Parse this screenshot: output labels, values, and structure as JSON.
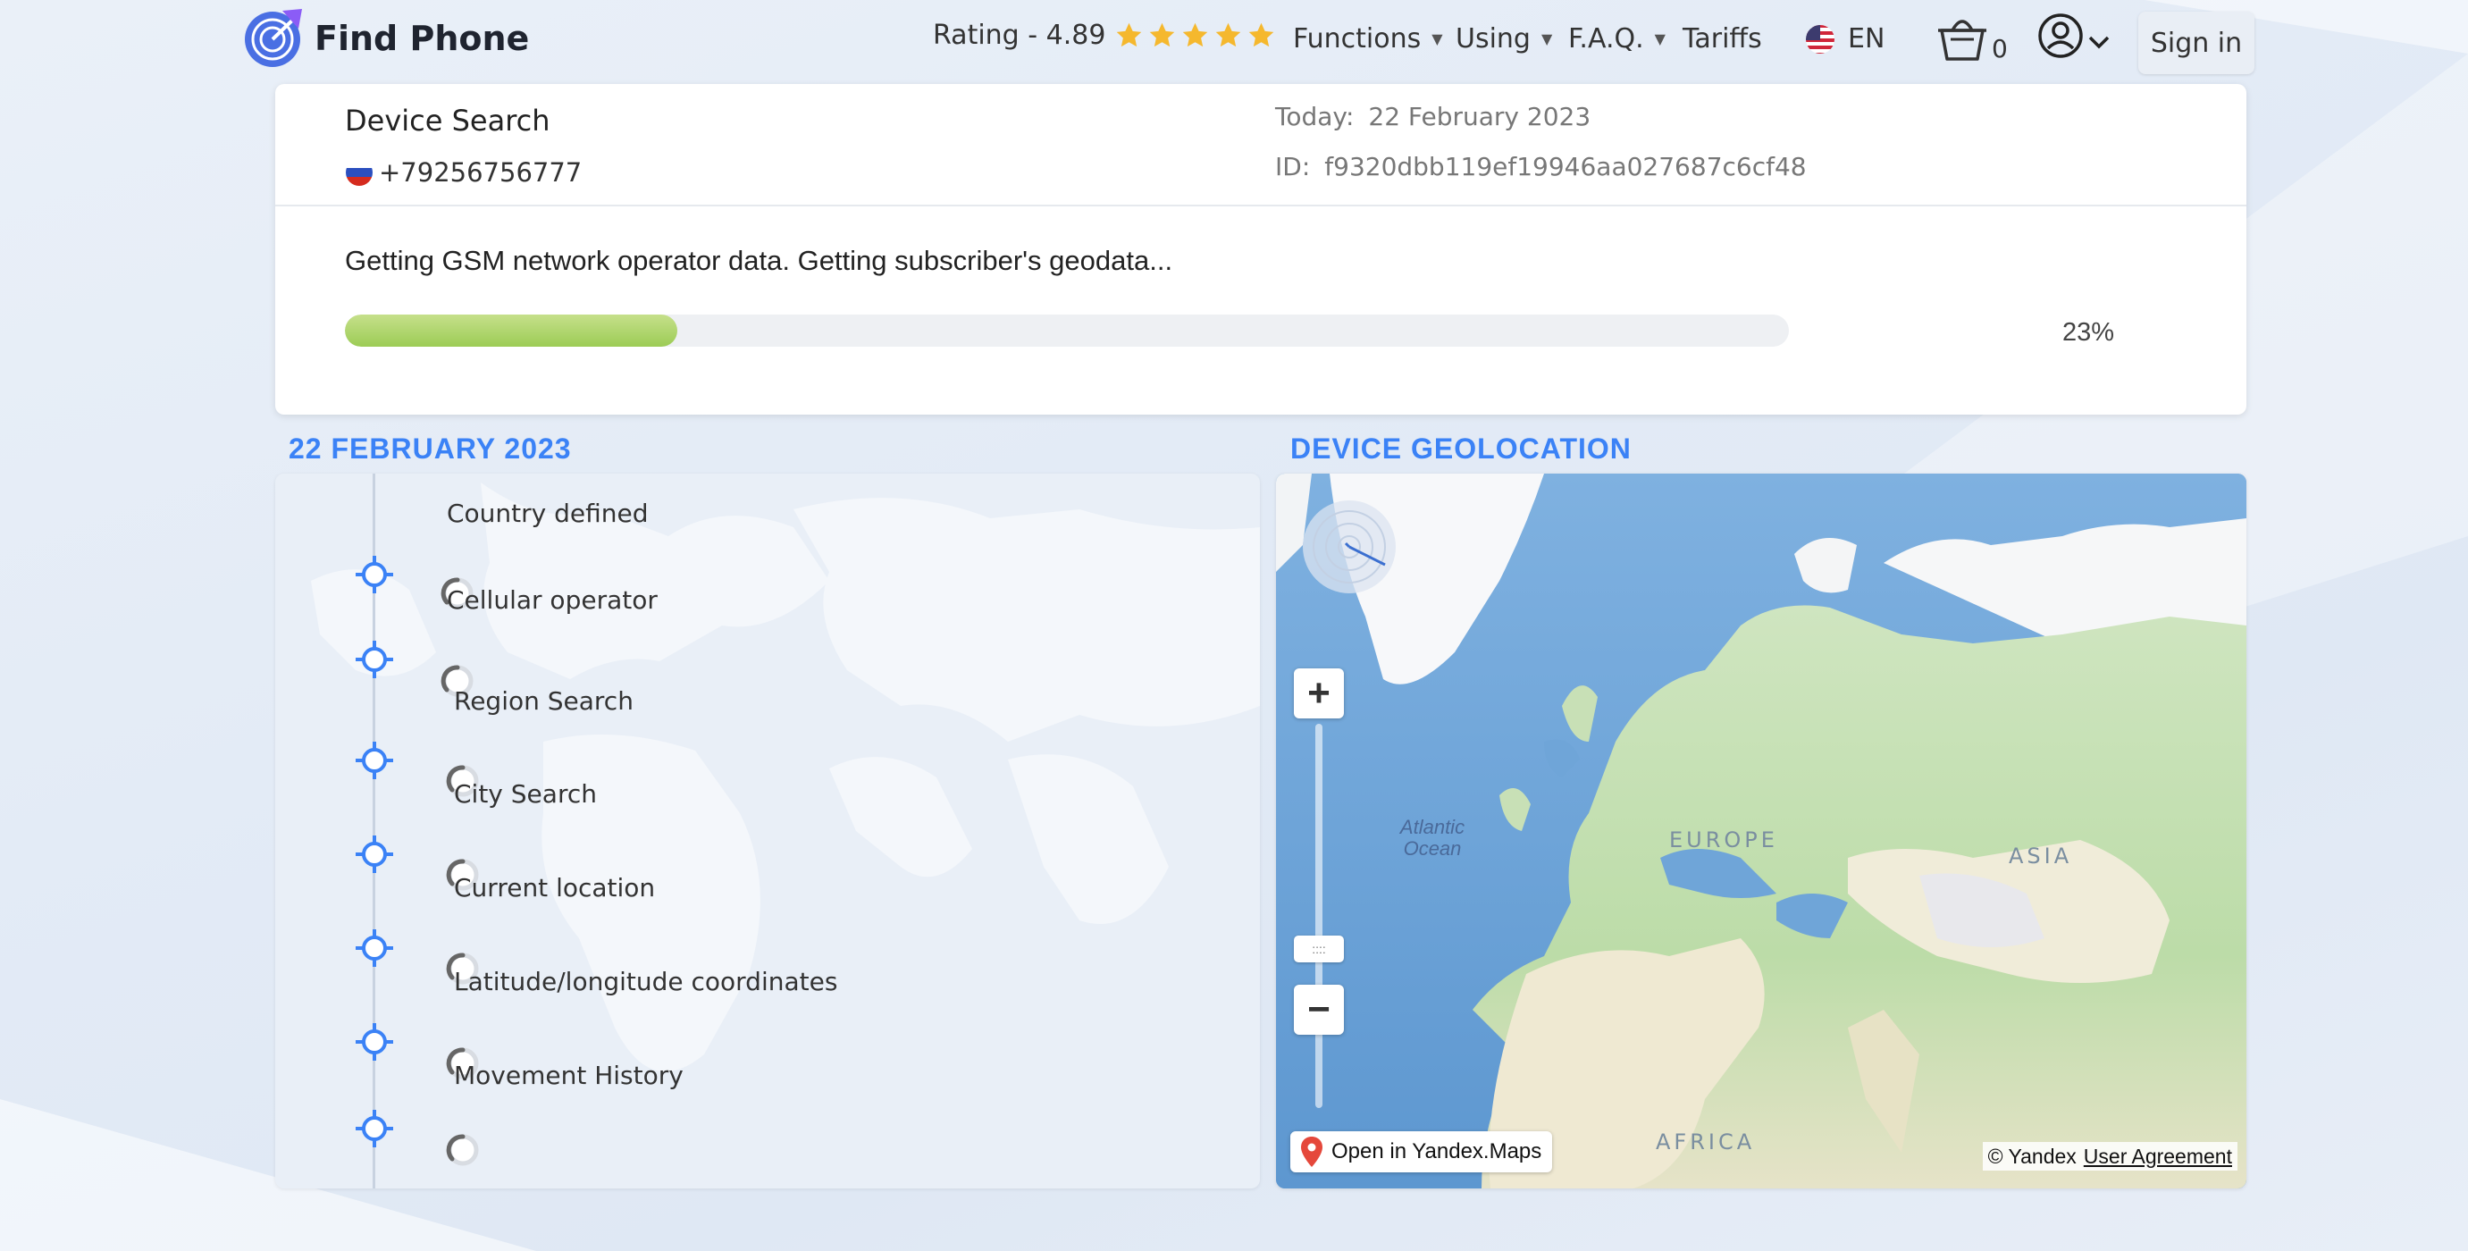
{
  "header": {
    "brand": "Find Phone",
    "rating_label": "Rating - 4.89",
    "rating_stars": 5,
    "nav": {
      "functions": "Functions",
      "using": "Using",
      "faq": "F.A.Q.",
      "tariffs": "Tariffs",
      "language": "EN",
      "cart_count": "0",
      "sign_in": "Sign in"
    }
  },
  "search_card": {
    "title": "Device Search",
    "phone": "+79256756777",
    "today_label": "Today:",
    "today_value": "22 February 2023",
    "id_label": "ID:",
    "id_value": "f9320dbb119ef19946aa027687c6cf48",
    "status": "Getting GSM network operator data. Getting subscriber's geodata...",
    "progress_percent": 23,
    "progress_text": "23%"
  },
  "timeline": {
    "title": "22 FEBRUARY 2023",
    "steps": [
      {
        "label": "Country defined"
      },
      {
        "label": "Cellular operator"
      },
      {
        "label": "Region Search"
      },
      {
        "label": "City Search"
      },
      {
        "label": "Current location"
      },
      {
        "label": "Latitude/longitude coordinates"
      },
      {
        "label": "Movement History"
      }
    ]
  },
  "geolocation": {
    "title": "DEVICE GEOLOCATION",
    "labels": {
      "europe": "EUROPE",
      "asia": "ASIA",
      "africa": "AFRICA",
      "ocean": "Atlantic Ocean"
    },
    "zoom_in": "+",
    "zoom_out": "−",
    "zoom_handle": "::::",
    "open_maps": "Open in Yandex.Maps",
    "copyright": "© Yandex",
    "user_agreement": "User Agreement"
  },
  "colors": {
    "accent": "#3b82f6",
    "progress": "#a8d06a",
    "star": "#f5b82e"
  }
}
